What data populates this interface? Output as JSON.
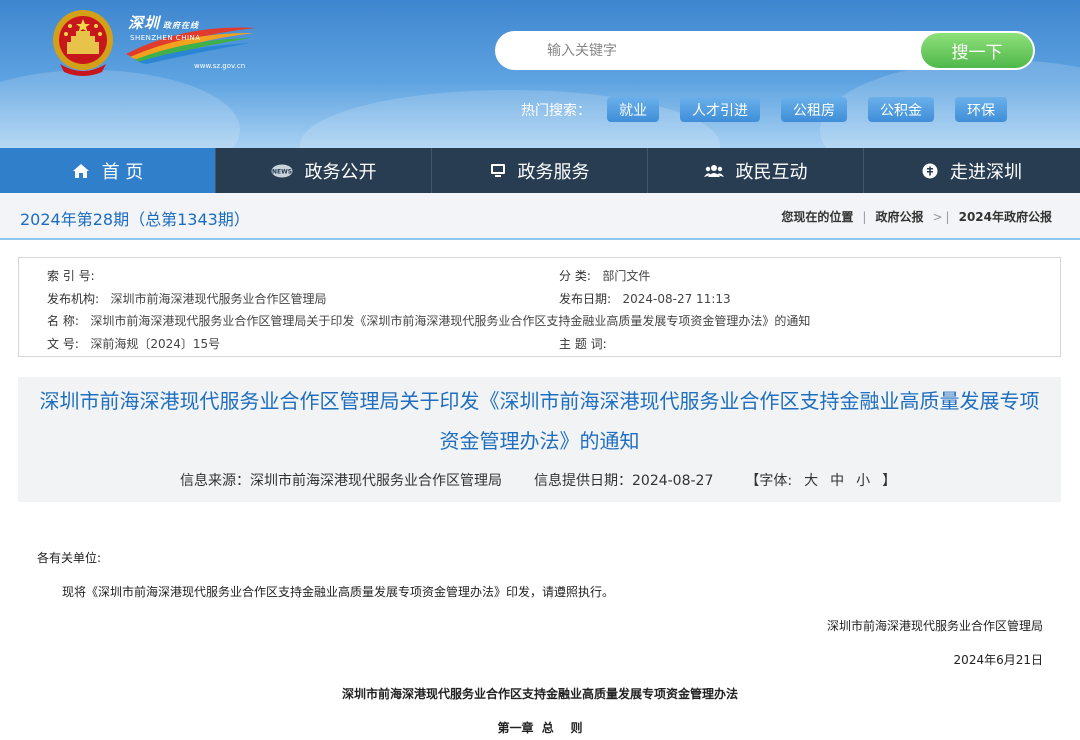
{
  "header": {
    "logo": {
      "cn_name": "深圳",
      "cn_sub": "政府在线",
      "en_name": "SHENZHEN CHINA",
      "url": "www.sz.gov.cn"
    },
    "search": {
      "placeholder": "输入关键字",
      "button_label": "搜一下"
    },
    "hot_search": {
      "label": "热门搜索：",
      "tags": [
        "就业",
        "人才引进",
        "公租房",
        "公积金",
        "环保"
      ]
    }
  },
  "nav": {
    "items": [
      {
        "label": "首 页",
        "icon": "home-icon",
        "active": true
      },
      {
        "label": "政务公开",
        "icon": "news-icon",
        "active": false
      },
      {
        "label": "政务服务",
        "icon": "monitor-icon",
        "active": false
      },
      {
        "label": "政民互动",
        "icon": "users-icon",
        "active": false
      },
      {
        "label": "走进深圳",
        "icon": "info-icon",
        "active": false
      }
    ]
  },
  "issue": {
    "title": "2024年第28期（总第1343期）",
    "breadcrumb": {
      "prefix": "您现在的位置",
      "items": [
        "政府公报",
        "2024年政府公报"
      ],
      "separator": ">"
    }
  },
  "meta": {
    "index_label": "索 引 号:",
    "index_value": "",
    "category_label": "分 类:",
    "category_value": "部门文件",
    "publisher_label": "发布机构:",
    "publisher_value": "深圳市前海深港现代服务业合作区管理局",
    "date_label": "发布日期:",
    "date_value": "2024-08-27 11:13",
    "name_label": "名 称:",
    "name_value": "深圳市前海深港现代服务业合作区管理局关于印发《深圳市前海深港现代服务业合作区支持金融业高质量发展专项资金管理办法》的通知",
    "docno_label": "文 号:",
    "docno_value": "深前海规〔2024〕15号",
    "keywords_label": "主 题 词:",
    "keywords_value": ""
  },
  "article": {
    "title": "深圳市前海深港现代服务业合作区管理局关于印发《深圳市前海深港现代服务业合作区支持金融业高质量发展专项资金管理办法》的通知",
    "source": "信息来源：深圳市前海深港现代服务业合作区管理局",
    "provide_date": "信息提供日期：2024-08-27",
    "font_size_label": "【字体:",
    "font_sizes": [
      "大",
      "中",
      "小"
    ],
    "font_size_close": "】",
    "greeting": "各有关单位:",
    "paragraph": "现将《深圳市前海深港现代服务业合作区支持金融业高质量发展专项资金管理办法》印发，请遵照执行。",
    "signature": "深圳市前海深港现代服务业合作区管理局",
    "sign_date": "2024年6月21日",
    "attachment_title": "深圳市前海深港现代服务业合作区支持金融业高质量发展专项资金管理办法",
    "chapter_title": "第一章  总    则"
  },
  "colors": {
    "banner_top": "#3e86cf",
    "nav_bg": "#283d52",
    "nav_active": "#2f7fcb",
    "title_blue": "#1f6fc0",
    "search_button": "#4fb84a"
  }
}
